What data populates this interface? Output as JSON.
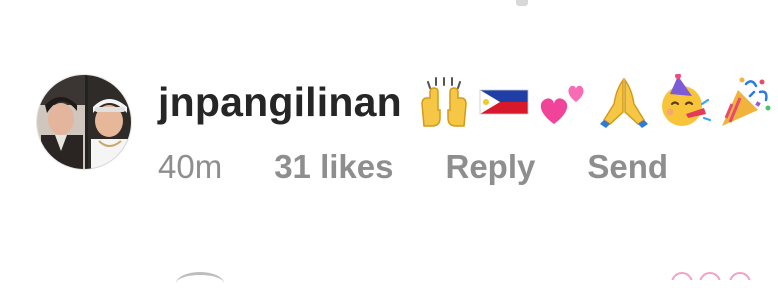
{
  "comment": {
    "username": "jnpangilinan",
    "emojis": [
      {
        "icon": "raising-hands-emoji"
      },
      {
        "icon": "philippines-flag-emoji"
      },
      {
        "icon": "two-hearts-emoji"
      },
      {
        "icon": "folded-hands-emoji"
      },
      {
        "icon": "partying-face-emoji"
      },
      {
        "icon": "party-popper-emoji"
      }
    ],
    "time": "40m",
    "likes": "31 likes",
    "reply_label": "Reply",
    "send_label": "Send"
  },
  "colors": {
    "username": "#262626",
    "meta": "#8e8e8e",
    "background": "#ffffff"
  }
}
